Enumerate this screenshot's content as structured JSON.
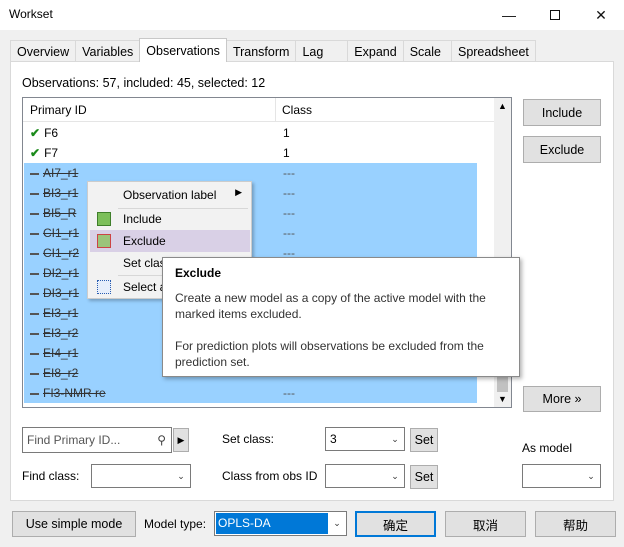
{
  "window": {
    "title": "Workset"
  },
  "tabs": [
    "Overview",
    "Variables",
    "Observations",
    "Transform",
    "Lag",
    "Expand",
    "Scale",
    "Spreadsheet"
  ],
  "summary": "Observations: 57, included: 45, selected: 12",
  "columns": {
    "id": "Primary ID",
    "class": "Class"
  },
  "rows": [
    {
      "id": "F6",
      "cls": "1"
    },
    {
      "id": "F7",
      "cls": "1"
    },
    {
      "id": "AI7_r1",
      "cls": "---"
    },
    {
      "id": "BI3_r1",
      "cls": "---"
    },
    {
      "id": "BI5_R",
      "cls": "---"
    },
    {
      "id": "CI1_r1",
      "cls": "---"
    },
    {
      "id": "CI1_r2",
      "cls": "---"
    },
    {
      "id": "DI2_r1",
      "cls": "---"
    },
    {
      "id": "DI3_r1",
      "cls": "---"
    },
    {
      "id": "EI3_r1",
      "cls": "---"
    },
    {
      "id": "EI3_r2",
      "cls": "---"
    },
    {
      "id": "EI4_r1",
      "cls": "---"
    },
    {
      "id": "EI8_r2",
      "cls": "---"
    },
    {
      "id": "FI3-NMR re",
      "cls": "---"
    }
  ],
  "side_buttons": {
    "include": "Include",
    "exclude": "Exclude",
    "more": "More »"
  },
  "context_menu": {
    "observation_label": "Observation label",
    "include": "Include",
    "exclude": "Exclude",
    "set_class": "Set clas",
    "select_all": "Select a"
  },
  "tooltip": {
    "title": "Exclude",
    "line1": "Create a new model as a copy of the active model with the marked items excluded.",
    "line2": "For prediction plots will observations be excluded from the prediction set."
  },
  "find": {
    "placeholder": "Find Primary ID...",
    "set_class_label": "Set class:",
    "set_class_value": "3",
    "set_button": "Set",
    "as_model_label": "As model",
    "find_class_label": "Find class:",
    "class_from_obs_label": "Class from obs ID",
    "set_button2": "Set"
  },
  "bottom": {
    "simple_mode": "Use simple mode",
    "model_type_label": "Model type:",
    "model_type_value": "OPLS-DA",
    "ok": "确定",
    "cancel": "取消",
    "help": "帮助"
  }
}
